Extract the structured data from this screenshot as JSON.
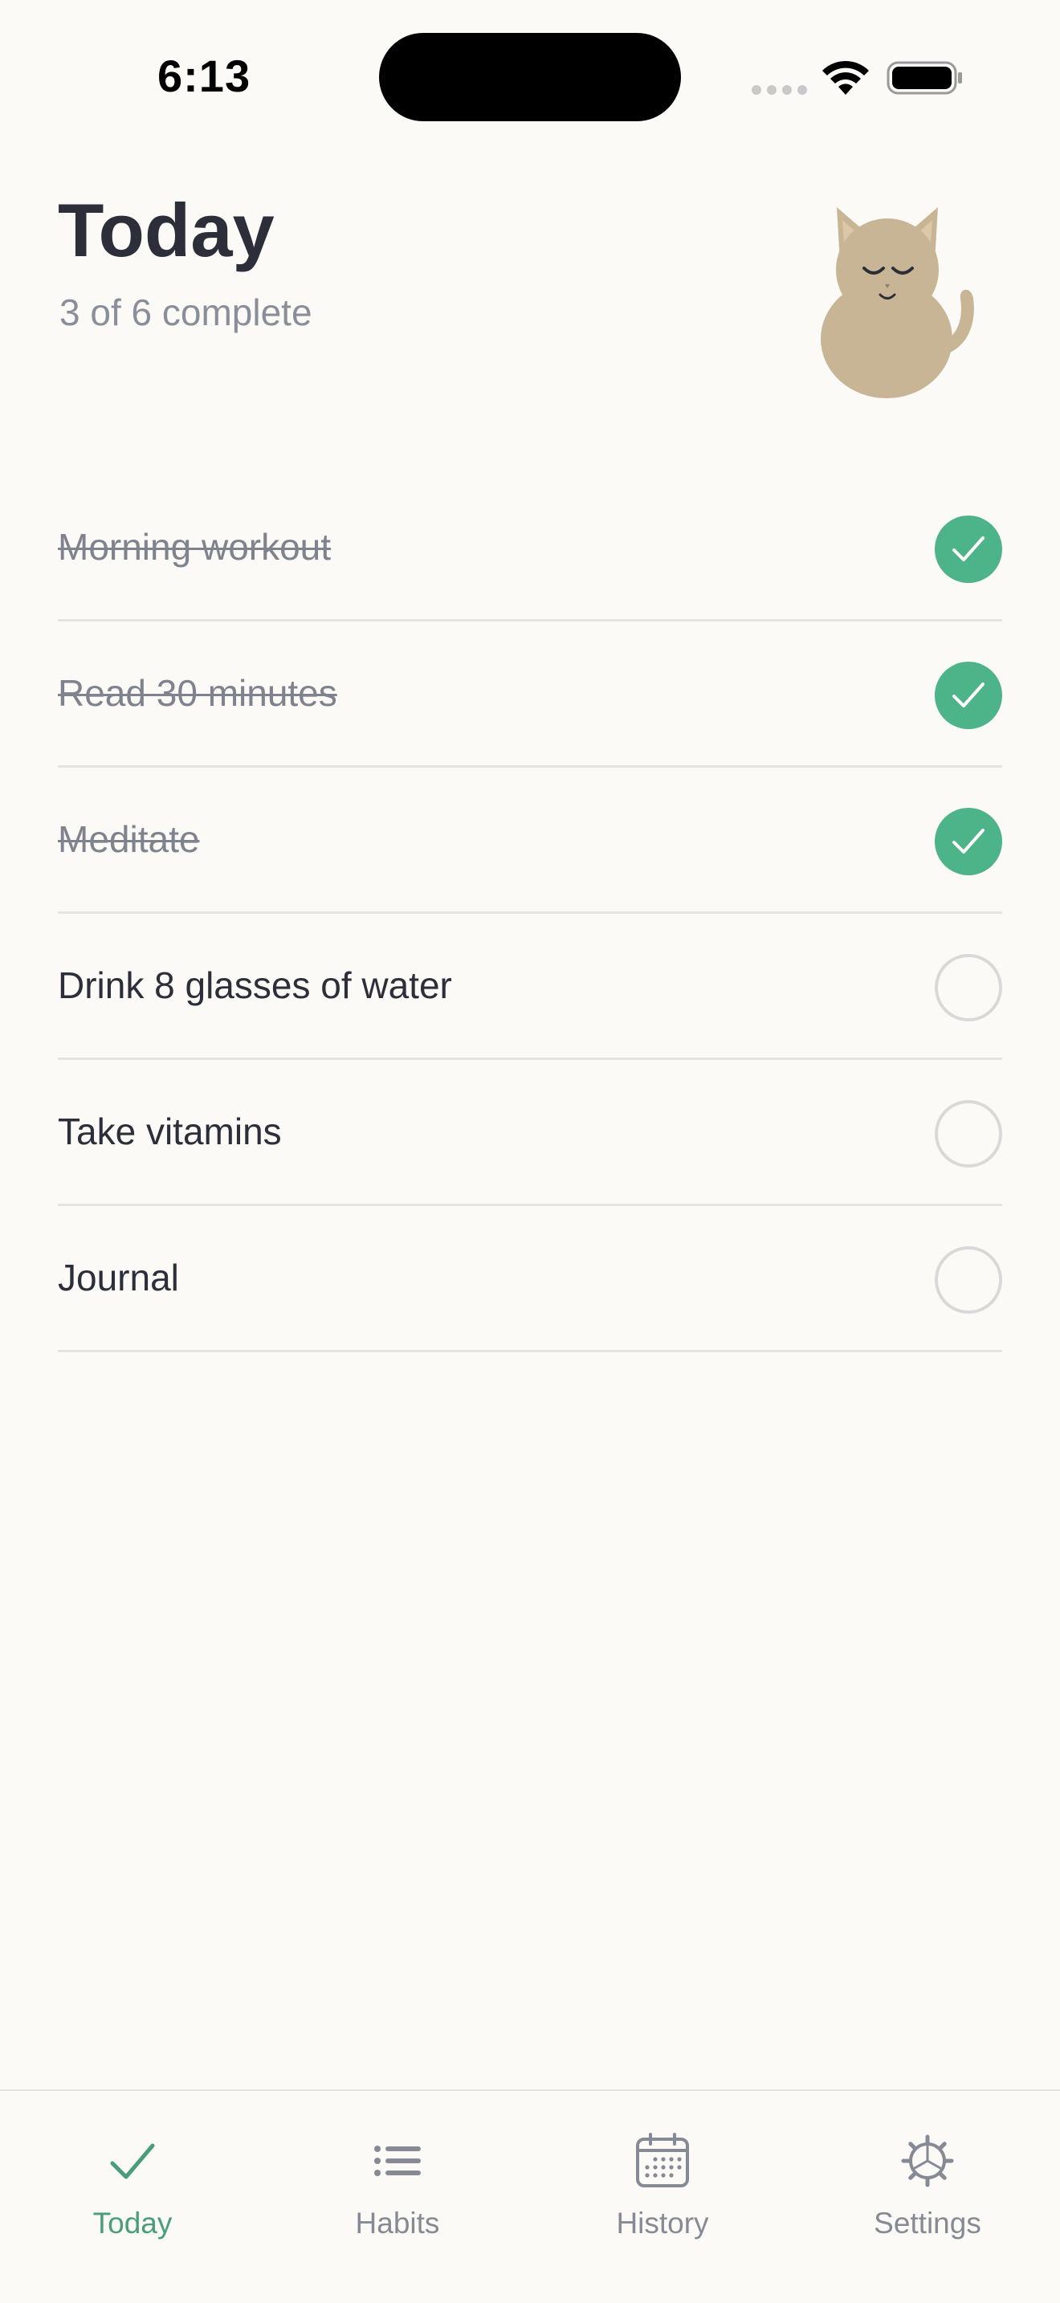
{
  "status_bar": {
    "time": "6:13"
  },
  "header": {
    "title": "Today",
    "progress": "3 of 6 complete",
    "completed": 3,
    "total": 6
  },
  "habits": [
    {
      "label": "Morning workout",
      "done": true
    },
    {
      "label": "Read 30 minutes",
      "done": true
    },
    {
      "label": "Meditate",
      "done": true
    },
    {
      "label": "Drink 8 glasses of water",
      "done": false
    },
    {
      "label": "Take vitamins",
      "done": false
    },
    {
      "label": "Journal",
      "done": false
    }
  ],
  "tab_bar": {
    "tabs": [
      {
        "label": "Today",
        "icon": "checkmark-icon",
        "active": true
      },
      {
        "label": "Habits",
        "icon": "list-icon",
        "active": false
      },
      {
        "label": "History",
        "icon": "calendar-icon",
        "active": false
      },
      {
        "label": "Settings",
        "icon": "gear-icon",
        "active": false
      }
    ]
  },
  "colors": {
    "background": "#fcfaf6",
    "accent": "#4db389",
    "accent_text": "#4a9d7a",
    "text_primary": "#2c2f3a",
    "text_secondary": "#8a8e99",
    "cat": "#c8b596"
  }
}
